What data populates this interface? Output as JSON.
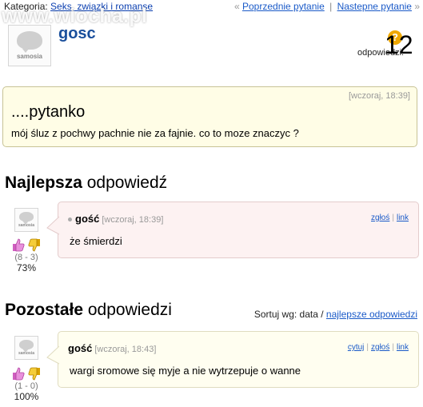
{
  "breadcrumb": {
    "label": "Kategoria:",
    "category": "Seks, związki i romanse"
  },
  "nav": {
    "prev_arrow": "«",
    "prev": "Poprzednie pytanie",
    "separator": "|",
    "next": "Nastepne pytanie",
    "next_arrow": "»"
  },
  "watermark": "www.wiocha.pl",
  "avatar_brand": "samosia",
  "question": {
    "author": "gosc",
    "answers_label": "odpowiedzi:",
    "answers_count": "12",
    "badge": "?",
    "time": "[wczoraj, 18:39]",
    "title": "....pytanko",
    "body": "mój śluz z pochwy pachnie nie za fajnie. co to moze znaczyc ?"
  },
  "best_section": {
    "title_bold": "Najlepsza",
    "title_rest": " odpowiedź"
  },
  "other_section": {
    "title_bold": "Pozostałe",
    "title_rest": " odpowiedzi",
    "sort_label": "Sortuj wg: data /",
    "sort_link": "najlepsze odpowiedzi"
  },
  "best_answer": {
    "author": "gość",
    "time": "[wczoraj, 18:39]",
    "report": "zgłoś",
    "link": "link",
    "text": "że śmierdzi",
    "votes": "(8 - 3)",
    "percent": "73%",
    "vote_up_pct": 0.73
  },
  "other_answer": {
    "author": "gość",
    "time": "[wczoraj, 18:43]",
    "quote": "cytuj",
    "report": "zgłoś",
    "link": "link",
    "text": "wargi sromowe się myje a nie wytrzepuje o wanne",
    "votes": "(1 - 0)",
    "percent": "100%",
    "vote_up_pct": 1.0
  },
  "colors": {
    "link": "#1a5ac8",
    "author": "#1a4f9c",
    "question_bg": "#fffde6",
    "best_bg": "#fdf2f2",
    "other_bg": "#fffef0",
    "badge": "#f0a800",
    "thumb_up": "#d05fc0",
    "thumb_down": "#e8b400"
  },
  "icons": [
    "question-mark-icon",
    "thumb-up-icon",
    "thumb-down-icon",
    "avatar-icon"
  ]
}
